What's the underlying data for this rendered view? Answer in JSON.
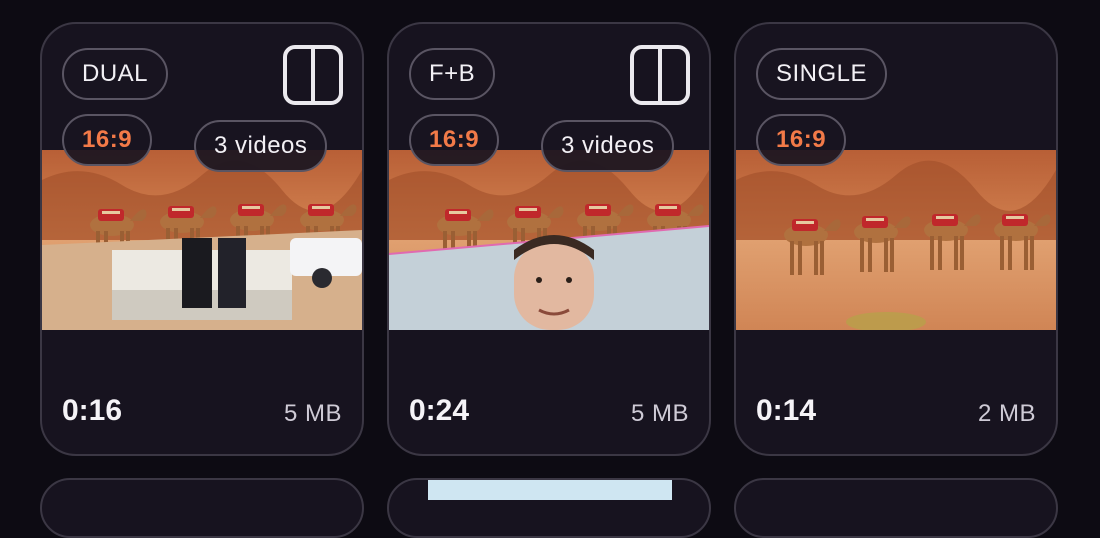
{
  "cards": [
    {
      "mode": "DUAL",
      "ratio": "16:9",
      "videos": "3 videos",
      "duration": "0:16",
      "size": "5 MB",
      "layout_icon": "split-layout-icon",
      "scene": "camels-over-truck"
    },
    {
      "mode": "F+B",
      "ratio": "16:9",
      "videos": "3 videos",
      "duration": "0:24",
      "size": "5 MB",
      "layout_icon": "split-layout-icon",
      "scene": "camels-over-face"
    },
    {
      "mode": "SINGLE",
      "ratio": "16:9",
      "duration": "0:14",
      "size": "2 MB",
      "scene": "camels-full"
    }
  ],
  "colors": {
    "accent": "#f27a48",
    "background": "#0d0b13",
    "card": "#17131f",
    "border": "#3b3744"
  }
}
